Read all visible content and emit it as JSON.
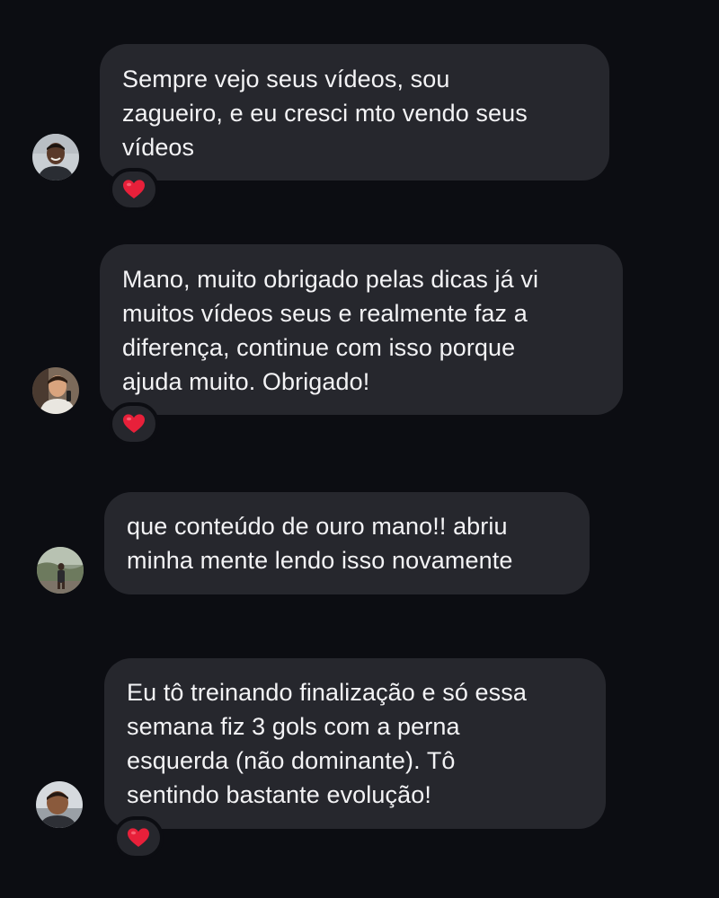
{
  "messages": [
    {
      "text": "Sempre vejo seus vídeos, sou\nzagueiro, e eu cresci mto vendo seus\nvídeos",
      "reaction": "heart-icon"
    },
    {
      "text": "Mano, muito obrigado pelas dicas já vi\nmuitos vídeos seus e realmente faz a\ndiferença, continue com isso porque\najuda muito. Obrigado!",
      "reaction": "heart-icon"
    },
    {
      "text": "que conteúdo de ouro mano!! abriu\nminha mente lendo isso novamente",
      "reaction": null
    },
    {
      "text": "Eu tô treinando finalização e só essa\nsemana fiz 3 gols com a perna\nesquerda (não dominante). Tô\nsentindo bastante evolução!",
      "reaction": "heart-icon"
    }
  ],
  "colors": {
    "background": "#0c0d12",
    "bubble": "#26272d",
    "text": "#f3f3f5",
    "heart": "#e8203a"
  }
}
